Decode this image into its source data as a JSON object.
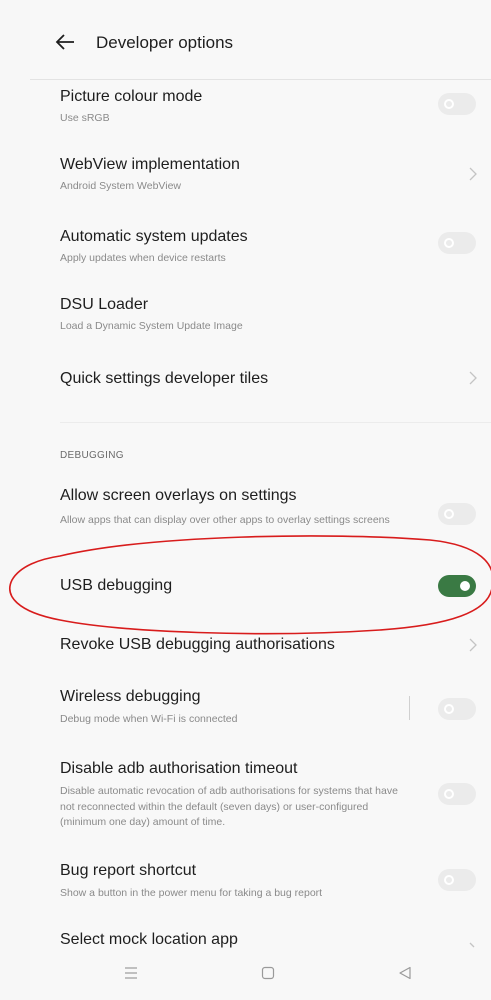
{
  "header": {
    "title": "Developer options"
  },
  "items": [
    {
      "title": "Picture colour mode",
      "subtitle": "Use sRGB",
      "control": "toggle",
      "state": "off"
    },
    {
      "title": "WebView implementation",
      "subtitle": "Android System WebView",
      "control": "chevron"
    },
    {
      "title": "Automatic system updates",
      "subtitle": "Apply updates when device restarts",
      "control": "toggle",
      "state": "off"
    },
    {
      "title": "DSU Loader",
      "subtitle": "Load a Dynamic System Update Image",
      "control": "none"
    },
    {
      "title": "Quick settings developer tiles",
      "subtitle": "",
      "control": "chevron"
    }
  ],
  "debugging": {
    "section_label": "DEBUGGING",
    "items": [
      {
        "title": "Allow screen overlays on settings",
        "subtitle": "Allow apps that can display over other apps to overlay settings screens",
        "control": "toggle",
        "state": "off"
      },
      {
        "title": "USB debugging",
        "subtitle": "",
        "control": "toggle",
        "state": "on"
      },
      {
        "title": "Revoke USB debugging authorisations",
        "subtitle": "",
        "control": "chevron"
      },
      {
        "title": "Wireless debugging",
        "subtitle": "Debug mode when Wi-Fi is connected",
        "control": "toggle",
        "state": "off"
      },
      {
        "title": "Disable adb authorisation timeout",
        "subtitle": "Disable automatic revocation of adb authorisations for systems that have not reconnected within the default (seven days) or user-configured (minimum one day) amount of time.",
        "control": "toggle",
        "state": "off"
      },
      {
        "title": "Bug report shortcut",
        "subtitle": "Show a button in the power menu for taking a bug report",
        "control": "toggle",
        "state": "off"
      },
      {
        "title": "Select mock location app",
        "subtitle": "",
        "control": "chevron"
      }
    ]
  },
  "colors": {
    "toggle_on": "#3a7a44",
    "toggle_off": "#ebebeb",
    "annotation": "#d81c1c"
  },
  "navbar": {
    "icons": [
      "menu-icon",
      "home-icon",
      "back-icon"
    ]
  }
}
